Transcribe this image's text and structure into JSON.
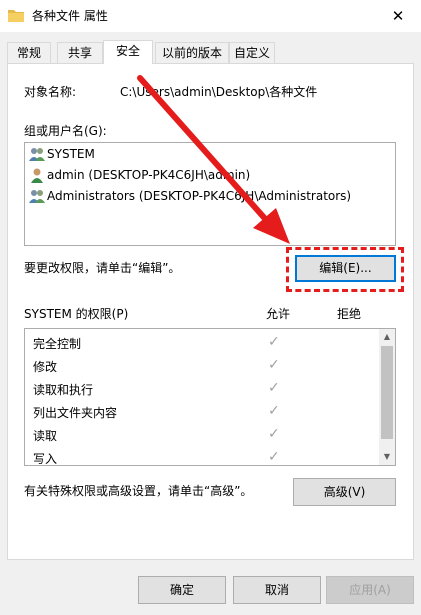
{
  "window": {
    "title": "各种文件 属性",
    "close_glyph": "✕"
  },
  "tabs": [
    {
      "label": "常规"
    },
    {
      "label": "共享"
    },
    {
      "label": "安全"
    },
    {
      "label": "以前的版本"
    },
    {
      "label": "自定义"
    }
  ],
  "object_name": {
    "label": "对象名称:",
    "value": "C:\\Users\\admin\\Desktop\\各种文件"
  },
  "groups": {
    "label": "组或用户名(G):",
    "items": [
      {
        "name": "SYSTEM",
        "icon": "user-group-icon"
      },
      {
        "name": "admin (DESKTOP-PK4C6JH\\admin)",
        "icon": "user-icon"
      },
      {
        "name": "Administrators (DESKTOP-PK4C6JH\\Administrators)",
        "icon": "user-group-icon"
      }
    ]
  },
  "edit_hint": "要更改权限，请单击“编辑”。",
  "edit_button": "编辑(E)...",
  "permissions": {
    "label": "SYSTEM 的权限(P)",
    "allow_label": "允许",
    "deny_label": "拒绝",
    "check_glyph": "✓",
    "rows": [
      {
        "name": "完全控制",
        "allow": true
      },
      {
        "name": "修改",
        "allow": true
      },
      {
        "name": "读取和执行",
        "allow": true
      },
      {
        "name": "列出文件夹内容",
        "allow": true
      },
      {
        "name": "读取",
        "allow": true
      },
      {
        "name": "写入",
        "allow": true
      }
    ]
  },
  "advanced_hint": "有关特殊权限或高级设置，请单击“高级”。",
  "advanced_button": "高级(V)",
  "footer": {
    "ok": "确定",
    "cancel": "取消",
    "apply": "应用(A)"
  },
  "colors": {
    "accent": "#0078d7",
    "annotation": "#e51c1c"
  }
}
